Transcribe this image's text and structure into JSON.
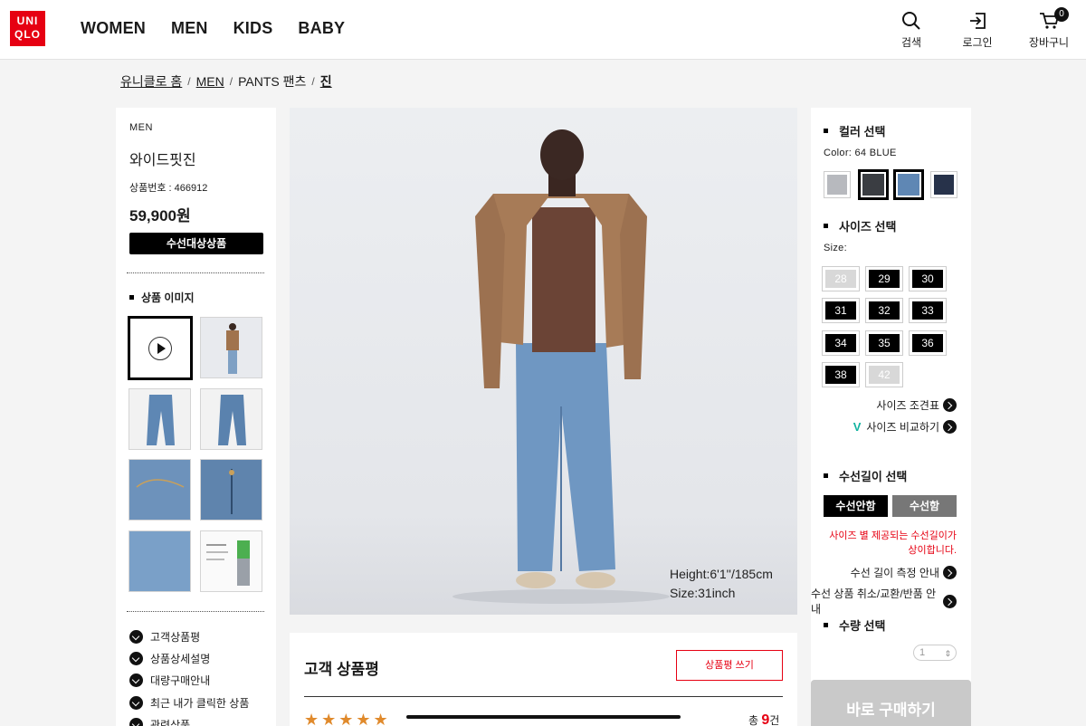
{
  "header": {
    "logo_text": "UNI QLO",
    "nav": [
      "WOMEN",
      "MEN",
      "KIDS",
      "BABY"
    ],
    "search_label": "검색",
    "login_label": "로그인",
    "cart_label": "장바구니",
    "cart_count": "0"
  },
  "breadcrumb": {
    "home": "유니클로 홈",
    "men": "MEN",
    "pants": "PANTS 팬츠",
    "current": "진",
    "sep": "/"
  },
  "product": {
    "category": "MEN",
    "name": "와이드핏진",
    "number": "상품번호 : 466912",
    "price": "59,900원",
    "alter_badge": "수선대상상품",
    "images_heading": "상품 이미지",
    "links": [
      "고객상품평",
      "상품상세설명",
      "대량구매안내",
      "최근 내가 클릭한 상품",
      "관련상품"
    ]
  },
  "main_image": {
    "caption_height": "Height:6'1''/185cm",
    "caption_size": "Size:31inch"
  },
  "review": {
    "title": "고객 상품평",
    "write_button": "상품평 쓰기",
    "stars": "★★★★★",
    "rating": 5,
    "total_prefix": "총",
    "total_count": "9",
    "total_suffix": "건"
  },
  "options": {
    "color_heading": "컬러 선택",
    "color_value": "Color: 64 BLUE",
    "swatches": [
      {
        "name": "gray",
        "color": "#b7b9be",
        "selected": false
      },
      {
        "name": "dark-gray",
        "color": "#3a3d42",
        "selected": true
      },
      {
        "name": "blue",
        "color": "#5f87b4",
        "selected": true
      },
      {
        "name": "navy",
        "color": "#27324a",
        "selected": false
      }
    ],
    "size_heading": "사이즈 선택",
    "size_label": "Size:",
    "sizes": [
      "28",
      "29",
      "30",
      "31",
      "32",
      "33",
      "34",
      "35",
      "36",
      "38",
      "42"
    ],
    "size_chart": "사이즈 조견표",
    "size_compare": "사이즈 비교하기",
    "hem_heading": "수선길이 선택",
    "hem_no": "수선안함",
    "hem_yes": "수선함",
    "hem_warning": "사이즈 별 제공되는 수선길이가 상이합니다.",
    "hem_measure_link": "수선 길이 측정 안내",
    "hem_policy_link": "수선 상품 취소/교환/반품 안내",
    "qty_heading": "수량 선택",
    "qty_value": "1",
    "buy_button": "바로 구매하기"
  }
}
